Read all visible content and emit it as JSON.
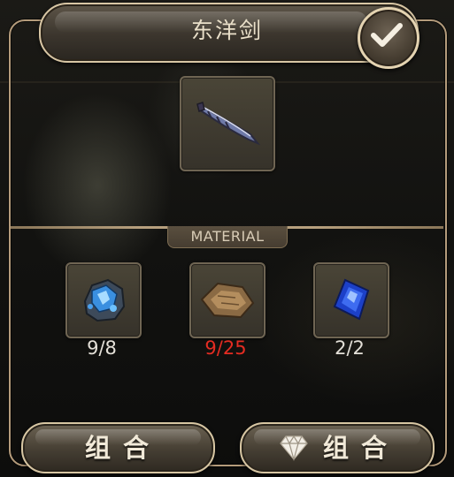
{
  "header": {
    "title": "东洋剑",
    "confirm_icon": "checkmark-icon"
  },
  "crafted_item": {
    "icon": "katana-sword-icon"
  },
  "materials_section": {
    "label": "MATERIAL",
    "items": [
      {
        "icon": "blue-crystal-ore-icon",
        "count": "9/8",
        "sufficient": true
      },
      {
        "icon": "leather-scrap-icon",
        "count": "9/25",
        "sufficient": false
      },
      {
        "icon": "sapphire-gem-icon",
        "count": "2/2",
        "sufficient": true
      }
    ]
  },
  "footer": {
    "combine_button_label": "组合",
    "gem_combine_button_label": "组合",
    "gem_icon": "diamond-icon"
  },
  "colors": {
    "frame_gold": "#b49b7b",
    "insufficient_red": "#e42c22",
    "count_white": "#e4e0d8"
  }
}
